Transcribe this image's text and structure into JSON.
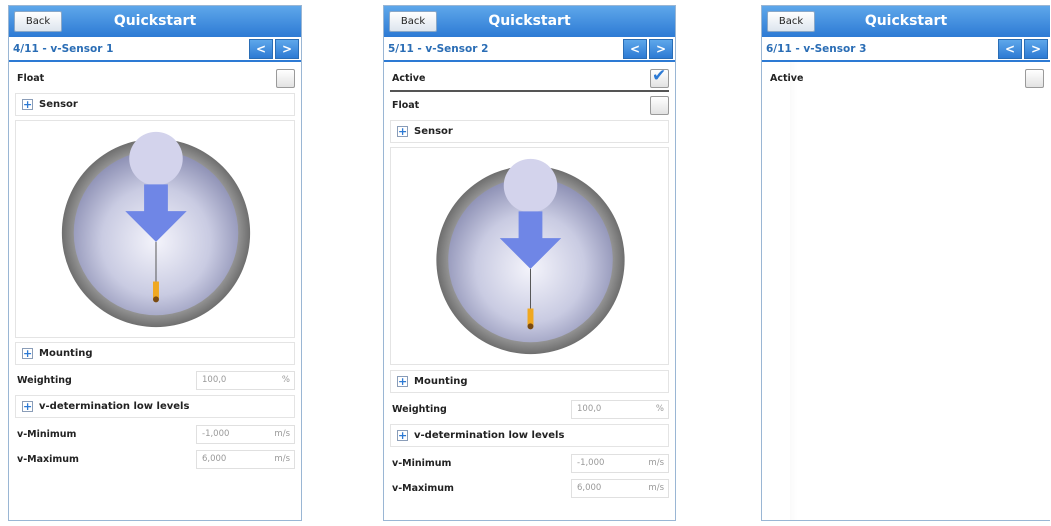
{
  "header": {
    "title": "Quickstart",
    "back_label": "Back"
  },
  "nav": {
    "prev_label": "<",
    "next_label": ">"
  },
  "panels": [
    {
      "step": "4/11 - v-Sensor 1",
      "float_label": "Float",
      "sensor_label": "Sensor",
      "mounting_label": "Mounting",
      "weighting_label": "Weighting",
      "weighting_value": "100,0",
      "weighting_unit": "%",
      "low_levels_label": "v-determination low levels",
      "vmin_label": "v-Minimum",
      "vmin_value": "-1,000",
      "vmin_unit": "m/s",
      "vmax_label": "v-Maximum",
      "vmax_value": "6,000",
      "vmax_unit": "m/s"
    },
    {
      "step": "5/11 - v-Sensor 2",
      "active_label": "Active",
      "active_checked": true,
      "float_label": "Float",
      "sensor_label": "Sensor",
      "mounting_label": "Mounting",
      "weighting_label": "Weighting",
      "weighting_value": "100,0",
      "weighting_unit": "%",
      "low_levels_label": "v-determination low levels",
      "vmin_label": "v-Minimum",
      "vmin_value": "-1,000",
      "vmin_unit": "m/s",
      "vmax_label": "v-Maximum",
      "vmax_value": "6,000",
      "vmax_unit": "m/s"
    },
    {
      "step": "6/11 - v-Sensor 3",
      "active_label": "Active",
      "active_checked": false
    }
  ],
  "colors": {
    "header_blue": "#2d7ad4",
    "pipe_gray": "#8c8c8c",
    "flow_arrow": "#6f86e6",
    "sensor_orange": "#f0a820"
  },
  "icons": {
    "expand": "plus-icon",
    "check": "checkmark-icon"
  }
}
